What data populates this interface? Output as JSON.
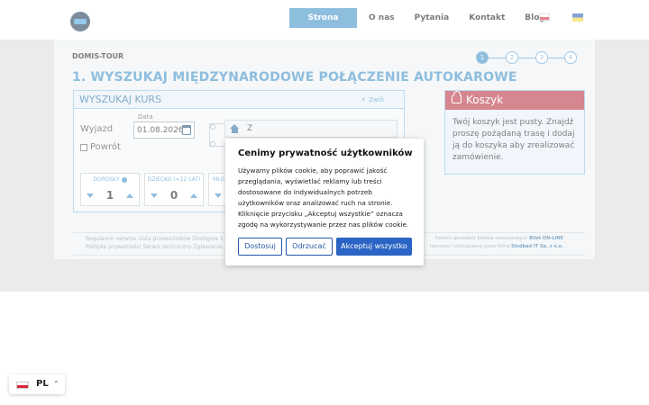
{
  "header": {
    "nav": [
      "Strona główna",
      "O nas",
      "Pytania",
      "Kontakt",
      "Blog"
    ],
    "active_index": 0
  },
  "brand": "DOMIS-TOUR",
  "steps": [
    "1",
    "2",
    "3",
    "4"
  ],
  "active_step": 1,
  "headline": "1. WYSZUKAJ MIĘDZYNARODOWE POŁĄCZENIE AUTOKAROWE",
  "search": {
    "title": "WYSZUKAJ KURS",
    "collapse_label": "Zwiń",
    "departure_label": "Wyjazd",
    "date_label": "Data",
    "date_value": "01.08.2026",
    "return_label": "Powrót",
    "destination_prefix": "Z",
    "passengers": [
      {
        "label": "DOROSŁY",
        "value": "1"
      },
      {
        "label": "DZIECKO (<12 LAT)",
        "value": "0"
      },
      {
        "label": "MŁO",
        "value": ""
      }
    ]
  },
  "cart": {
    "title": "Koszyk",
    "text": "Twój koszyk jest pusty. Znajdź proszę pożądaną trasę i dodaj ją do koszyka aby zrealizować zamówienie."
  },
  "footer": {
    "left_line1": "Regulamin serwisu   Lista przewoźników   Dostępne k",
    "left_line2": "Polityka prywatności   Serwis techniczny   Zgłaszanie",
    "right_line1_prefix": "System sprzedaży biletów autobusowych",
    "right_line1_brand": "Bilet ON-LINE",
    "right_line2_prefix": "tworzony i obsługiwany przez firmę",
    "right_line2_brand": "Sindbad IT Sp. z o.o."
  },
  "cookie_modal": {
    "title": "Cenimy prywatność użytkowników",
    "text": "Używamy plików cookie, aby poprawić jakość przeglądania, wyświetlać reklamy lub treści dostosowane do indywidualnych potrzeb użytkowników oraz analizować ruch na stronie. Kliknięcie przycisku „Akceptuj wszystkie” oznacza zgodę na wykorzystywanie przez nas plików cookie.",
    "btn_customize": "Dostosuj",
    "btn_reject": "Odrzucać",
    "btn_accept": "Akceptuj wszystko"
  },
  "language": {
    "code": "PL"
  },
  "colors": {
    "primary": "#3d8fc7",
    "cart_header": "#b7303d",
    "accept_button": "#2a64c4"
  }
}
